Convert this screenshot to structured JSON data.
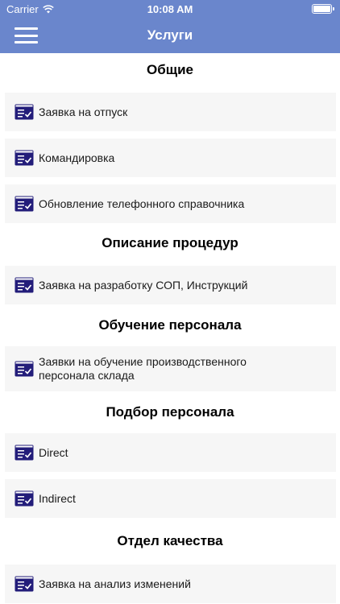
{
  "status_bar": {
    "carrier": "Carrier",
    "time": "10:08 AM"
  },
  "nav": {
    "title": "Услуги",
    "menu_icon": "hamburger-icon"
  },
  "colors": {
    "accent": "#6a86cc",
    "icon": "#231d7a",
    "card": "#f6f6f6"
  },
  "sections": [
    {
      "title": "Общие",
      "items": [
        "Заявка на отпуск",
        "Командировка",
        "Обновление телефонного справочника"
      ]
    },
    {
      "title": "Описание процедур",
      "items": [
        "Заявка на разработку СОП, Инструкций"
      ]
    },
    {
      "title": "Обучение персонала",
      "items": [
        "Заявки на обучение производственного персонала склада"
      ]
    },
    {
      "title": "Подбор персонала",
      "items": [
        "Direct",
        "Indirect"
      ]
    },
    {
      "title": "Отдел качества",
      "items": [
        "Заявка на анализ изменений"
      ]
    }
  ],
  "item_icon": "service-request-icon"
}
